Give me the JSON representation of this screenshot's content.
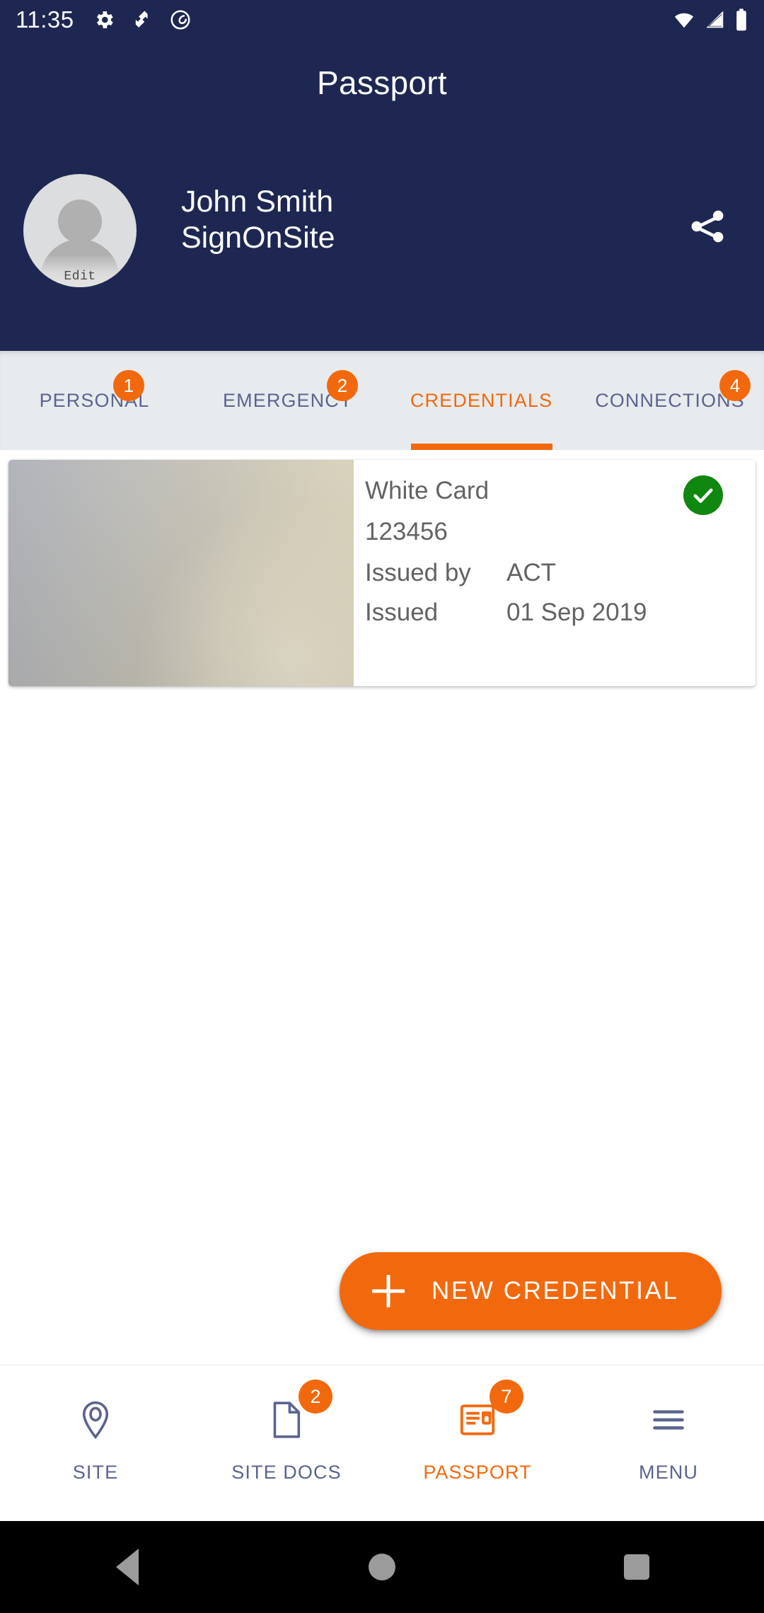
{
  "statusbar": {
    "time": "11:35",
    "icons": [
      "gear-icon",
      "signonsite-logo-icon",
      "circle-at-icon"
    ],
    "right_icons": [
      "wifi-icon",
      "cell-signal-icon",
      "battery-icon"
    ]
  },
  "header": {
    "title": "Passport",
    "profile": {
      "name": "John Smith",
      "org": "SignOnSite",
      "avatar_edit_label": "Edit"
    },
    "share_icon": "share-icon"
  },
  "tabs": [
    {
      "label": "PERSONAL",
      "badge": "1",
      "active": false
    },
    {
      "label": "EMERGENCY",
      "badge": "2",
      "active": false
    },
    {
      "label": "CREDENTIALS",
      "badge": "",
      "active": true
    },
    {
      "label": "CONNECTIONS",
      "badge": "4",
      "active": false
    }
  ],
  "credentials": [
    {
      "title": "White Card",
      "number": "123456",
      "issued_by_label": "Issued by",
      "issued_by_value": "ACT",
      "issued_label": "Issued",
      "issued_value": "01 Sep 2019",
      "status_icon": "verified-check-icon"
    }
  ],
  "fab": {
    "label": "NEW CREDENTIAL",
    "icon": "plus-icon"
  },
  "bottomnav": [
    {
      "label": "SITE",
      "icon": "location-pin-icon",
      "badge": "",
      "active": false
    },
    {
      "label": "SITE DOCS",
      "icon": "document-icon",
      "badge": "2",
      "active": false
    },
    {
      "label": "PASSPORT",
      "icon": "id-card-icon",
      "badge": "7",
      "active": true
    },
    {
      "label": "MENU",
      "icon": "hamburger-icon",
      "badge": "",
      "active": false
    }
  ],
  "sysnav": {
    "back": "back-triangle-icon",
    "home": "home-circle-icon",
    "recents": "recents-square-icon"
  },
  "colors": {
    "header_navy": "#1d2751",
    "accent_orange": "#f2690d",
    "tab_inactive": "#5b648f",
    "tabbar_bg": "#e8ebee",
    "verified_green": "#10870f",
    "text_grey": "#636363"
  }
}
